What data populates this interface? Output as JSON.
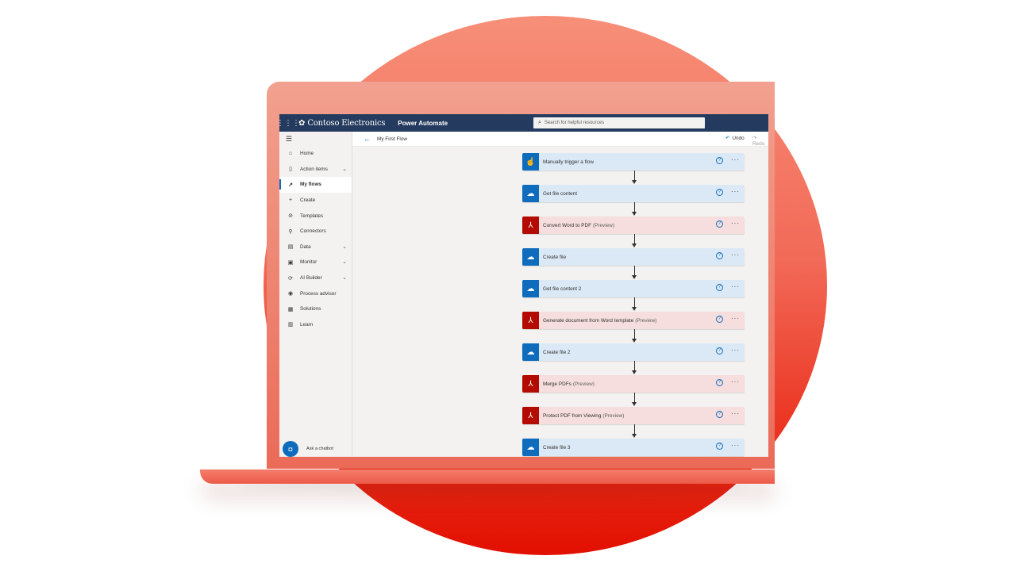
{
  "colors": {
    "brand_bar": "#243a5e",
    "accent": "#0f6cbd",
    "cloud_card": "#dbe9f6",
    "pdf_card": "#f5dedd",
    "pdf_tile": "#b30b00",
    "background_circle": "#f26a58"
  },
  "header": {
    "company_name": "Contoso Electronics",
    "app_name": "Power Automate",
    "search_placeholder": "Search for helpful resources",
    "icons": {
      "waffle": "waffle-icon",
      "logo": "contoso-logo-icon",
      "search": "search-icon"
    }
  },
  "sidebar": {
    "items": [
      {
        "label": "Home",
        "icon": "home-icon"
      },
      {
        "label": "Action items",
        "icon": "clipboard-icon",
        "expandable": true
      },
      {
        "label": "My flows",
        "icon": "flow-icon",
        "active": true
      },
      {
        "label": "Create",
        "icon": "plus-icon"
      },
      {
        "label": "Templates",
        "icon": "templates-icon"
      },
      {
        "label": "Connectors",
        "icon": "connector-icon"
      },
      {
        "label": "Data",
        "icon": "database-icon",
        "expandable": true
      },
      {
        "label": "Monitor",
        "icon": "monitor-icon",
        "expandable": true
      },
      {
        "label": "AI Builder",
        "icon": "ai-builder-icon",
        "expandable": true
      },
      {
        "label": "Process advisor",
        "icon": "process-advisor-icon"
      },
      {
        "label": "Solutions",
        "icon": "solutions-icon"
      },
      {
        "label": "Learn",
        "icon": "book-icon"
      }
    ],
    "chatbot_label": "Ask a chatbot"
  },
  "command_bar": {
    "flow_name": "My First Flow",
    "undo_label": "Undo",
    "redo_label": "Redo"
  },
  "flow": {
    "steps": [
      {
        "title": "Manually trigger a flow",
        "preview": "",
        "kind": "cloud",
        "icon": "hand-tap-icon"
      },
      {
        "title": "Get file content",
        "preview": "",
        "kind": "cloud",
        "icon": "cloud-icon"
      },
      {
        "title": "Convert Word to PDF",
        "preview": "(Preview)",
        "kind": "pdf",
        "icon": "adobe-pdf-icon"
      },
      {
        "title": "Create file",
        "preview": "",
        "kind": "cloud",
        "icon": "cloud-icon"
      },
      {
        "title": "Get file content 2",
        "preview": "",
        "kind": "cloud",
        "icon": "cloud-icon"
      },
      {
        "title": "Generate document from Word template",
        "preview": "(Preview)",
        "kind": "pdf",
        "icon": "adobe-pdf-icon"
      },
      {
        "title": "Create file 2",
        "preview": "",
        "kind": "cloud",
        "icon": "cloud-icon"
      },
      {
        "title": "Merge PDFs",
        "preview": "(Preview)",
        "kind": "pdf",
        "icon": "adobe-pdf-icon"
      },
      {
        "title": "Protect PDF from Viewing",
        "preview": "(Preview)",
        "kind": "pdf",
        "icon": "adobe-pdf-icon"
      },
      {
        "title": "Create file 3",
        "preview": "",
        "kind": "cloud",
        "icon": "cloud-icon"
      }
    ],
    "help_glyph": "?",
    "more_glyph": "···"
  }
}
